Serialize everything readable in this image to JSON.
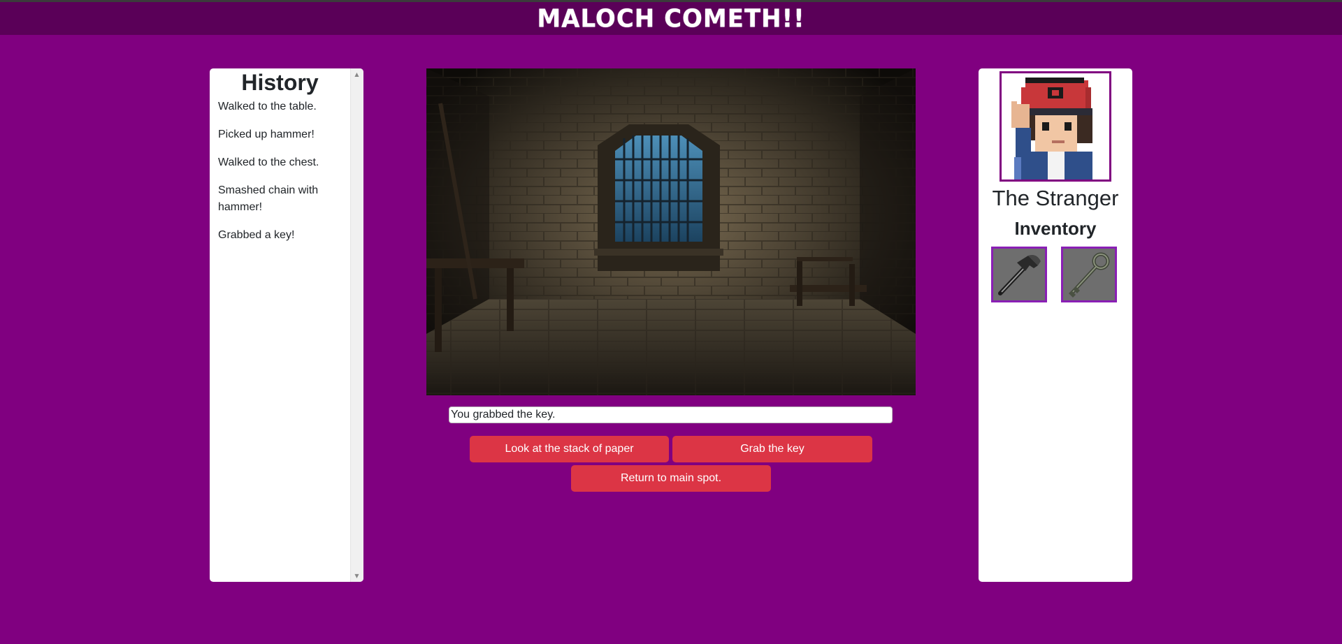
{
  "game": {
    "title": "MALOCH COMETH!!"
  },
  "history": {
    "heading": "History",
    "entries": [
      "Walked to the table.",
      "Picked up hammer!",
      "Walked to the chest.",
      "Smashed chain with hammer!",
      "Grabbed a key!"
    ]
  },
  "scene": {
    "icon": "dungeon-room-image"
  },
  "message": "You grabbed the key.",
  "actions": {
    "look_paper": "Look at the stack of paper",
    "grab_key": "Grab the key",
    "return_main": "Return to main spot."
  },
  "character": {
    "name": "The Stranger",
    "inventory_heading": "Inventory",
    "items": [
      {
        "icon": "hammer-icon"
      },
      {
        "icon": "key-icon"
      }
    ]
  },
  "colors": {
    "background": "#800080",
    "header": "#5a0058",
    "button": "#dc3545",
    "slot_border": "#8a1fb5"
  }
}
